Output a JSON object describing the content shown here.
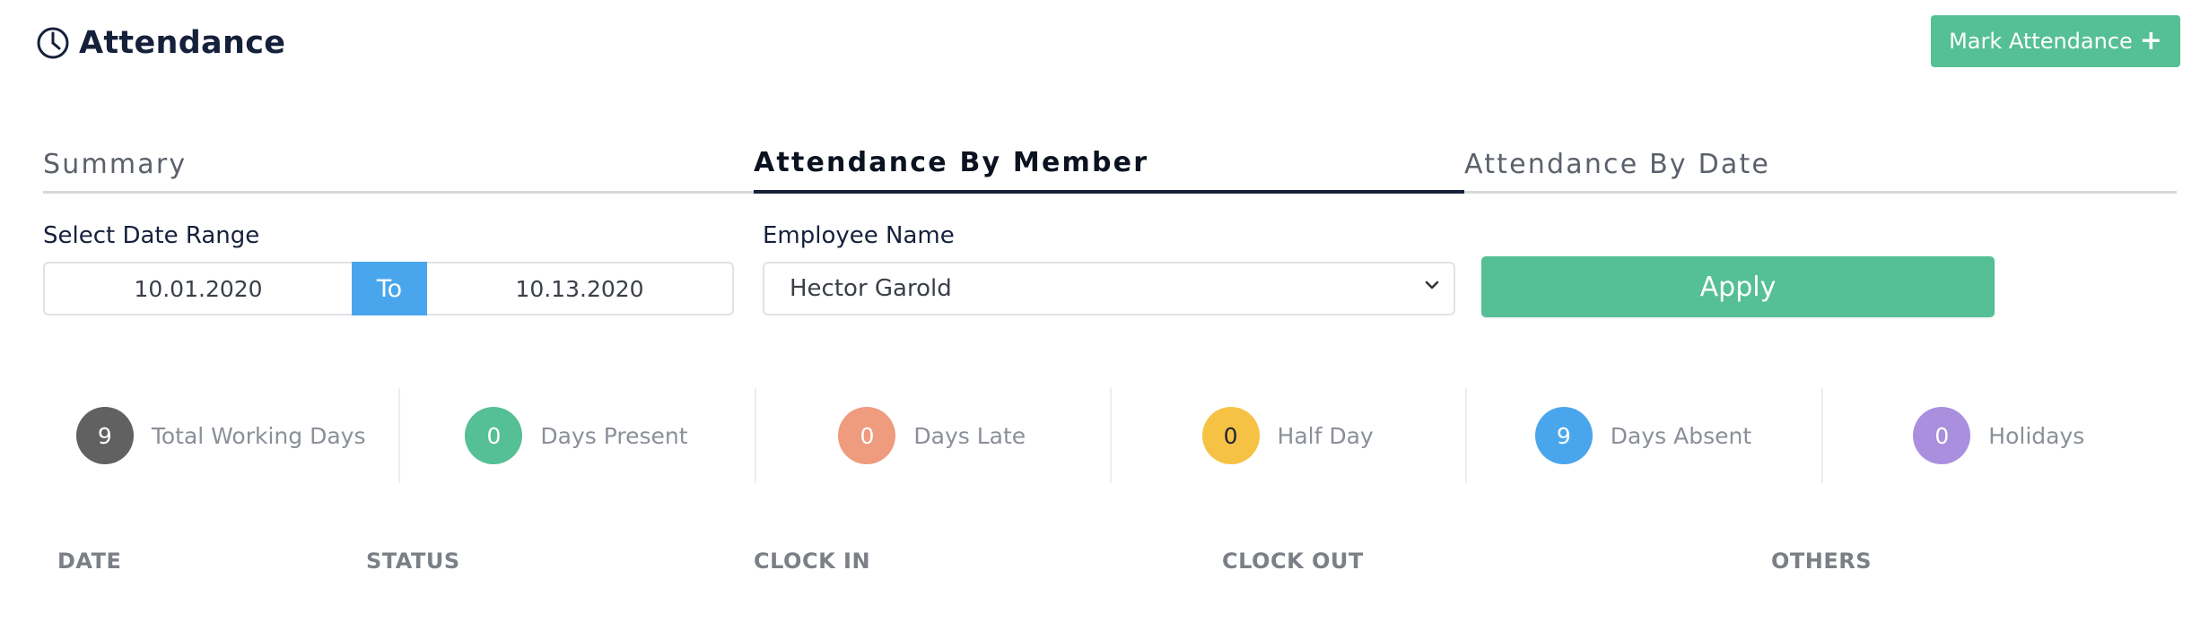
{
  "header": {
    "title": "Attendance",
    "mark_button_label": "Mark Attendance",
    "icon": "clock-icon"
  },
  "tabs": [
    {
      "label": "Summary",
      "active": false
    },
    {
      "label": "Attendance By Member",
      "active": true
    },
    {
      "label": "Attendance By Date",
      "active": false
    }
  ],
  "filters": {
    "date_range_label": "Select Date Range",
    "date_from": "10.01.2020",
    "to_label": "To",
    "date_to": "10.13.2020",
    "employee_label": "Employee Name",
    "employee_selected": "Hector Garold",
    "apply_label": "Apply"
  },
  "stats": [
    {
      "value": "9",
      "label": "Total Working Days",
      "color": "#616161"
    },
    {
      "value": "0",
      "label": "Days Present",
      "color": "#55bf95"
    },
    {
      "value": "0",
      "label": "Days Late",
      "color": "#ee9b7e"
    },
    {
      "value": "0",
      "label": "Half Day",
      "color": "#f6c244"
    },
    {
      "value": "9",
      "label": "Days Absent",
      "color": "#4aa6ec"
    },
    {
      "value": "0",
      "label": "Holidays",
      "color": "#a98fde"
    }
  ],
  "table": {
    "columns": [
      "DATE",
      "STATUS",
      "CLOCK IN",
      "CLOCK OUT",
      "OTHERS"
    ]
  },
  "colors": {
    "accent_green": "#55bf95",
    "accent_blue": "#4aa6ec",
    "title_navy": "#15203b"
  }
}
